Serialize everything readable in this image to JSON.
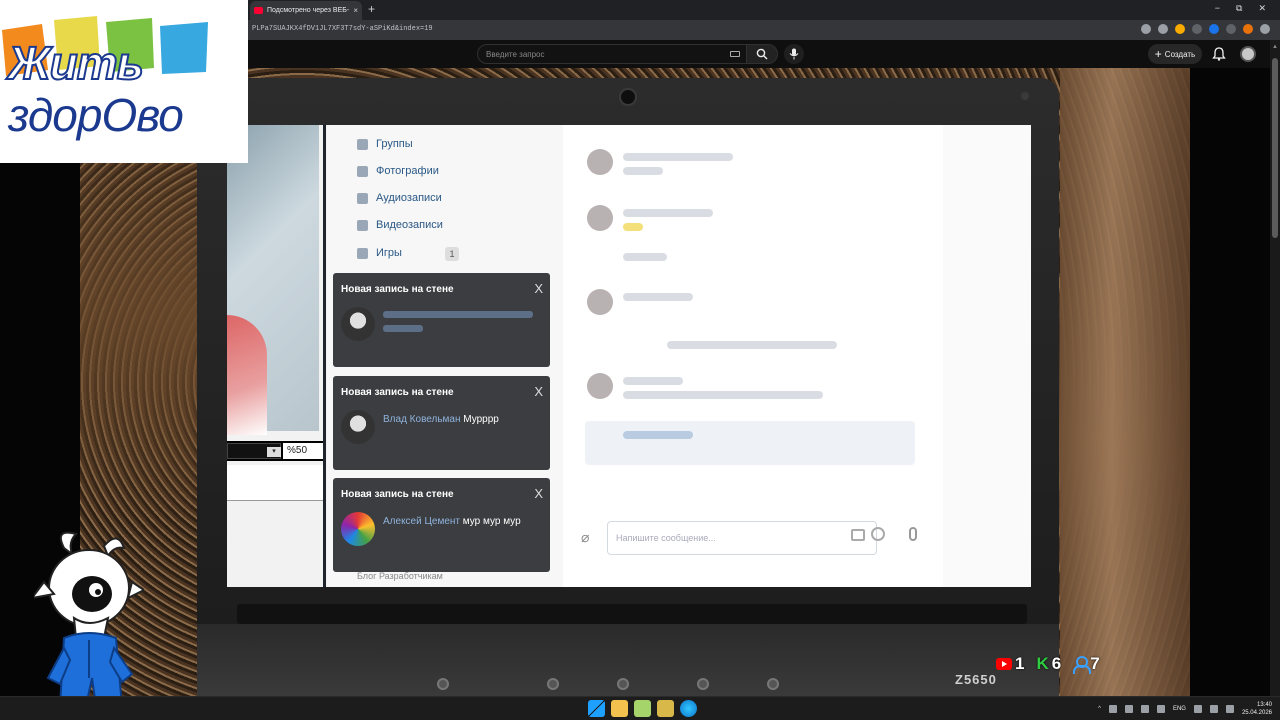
{
  "browser": {
    "tab_title": "Подсмотрено через ВЕБ-КАМ",
    "tab_close": "×",
    "new_tab": "+",
    "url": "PLPa7SUAJKX4fDV1JL7XF3T7sdY-aSPiKd&index=19",
    "window_controls": [
      "−",
      "⧉",
      "✕"
    ]
  },
  "youtube": {
    "search_placeholder": "Введите запрос",
    "create_label": "Создать"
  },
  "laptop": {
    "model": "Z5650"
  },
  "screen": {
    "zoom_value": "%50",
    "vk_menu": [
      {
        "label": "Группы"
      },
      {
        "label": "Фотографии"
      },
      {
        "label": "Аудиозаписи"
      },
      {
        "label": "Видеозаписи"
      },
      {
        "label": "Игры",
        "badge": "1"
      }
    ],
    "vk_footer": "Блог   Разработчикам",
    "chat_placeholder": "Напишите сообщение...",
    "notifications": [
      {
        "title": "Новая запись на стене",
        "close": "X",
        "name": "",
        "text": ""
      },
      {
        "title": "Новая запись на стене",
        "close": "X",
        "name": "Влад Ковельман",
        "text": "Мурррр"
      },
      {
        "title": "Новая запись на стене",
        "close": "X",
        "name": "Алексей Цемент",
        "text": "мур мур мур"
      }
    ]
  },
  "overlay": {
    "logo_line1": "Жить",
    "logo_line2": "здорОво",
    "stats": [
      {
        "icon": "youtube-icon",
        "value": "1"
      },
      {
        "icon": "k-icon",
        "value": "6"
      },
      {
        "icon": "user-icon",
        "value": "7"
      }
    ]
  },
  "taskbar": {
    "language": "ENG",
    "time": "13:40",
    "date": "25.04.2026"
  }
}
